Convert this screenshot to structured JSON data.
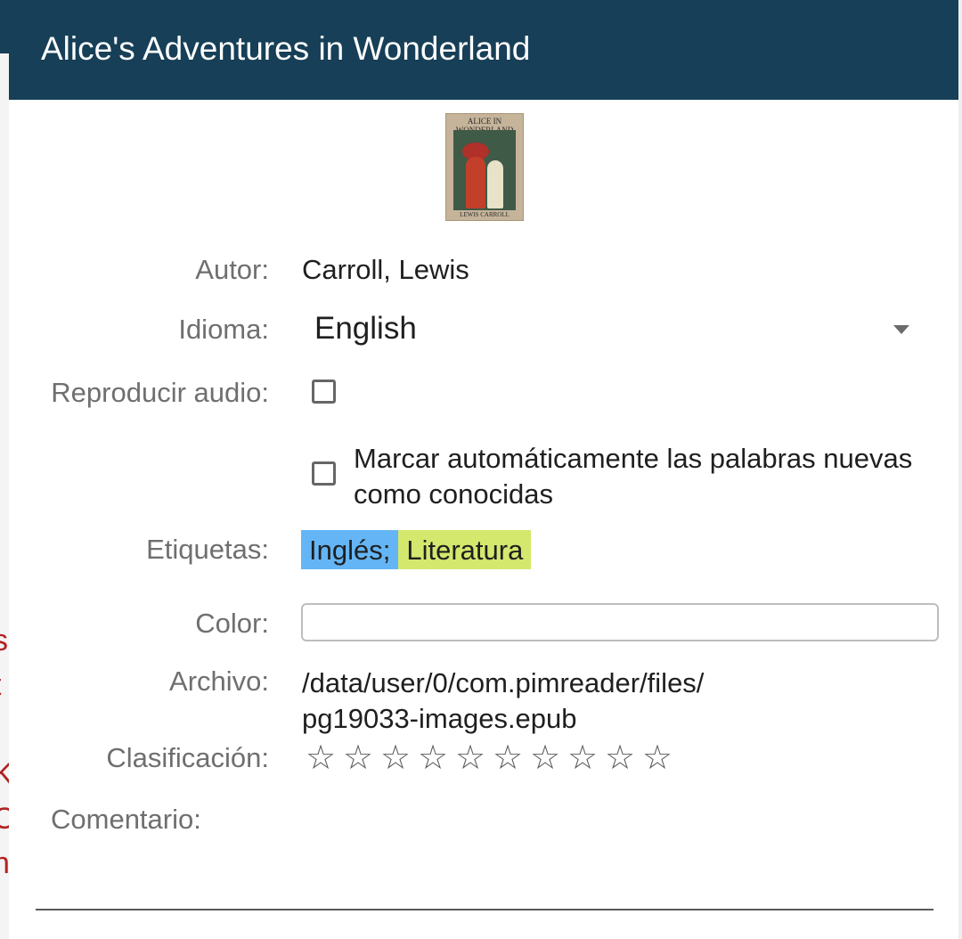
{
  "dialog": {
    "title": "Alice's Adventures in Wonderland"
  },
  "cover": {
    "title_text": "ALICE IN WONDERLAND",
    "author_text": "LEWIS CARROLL"
  },
  "fields": {
    "author": {
      "label": "Autor:",
      "value": "Carroll, Lewis"
    },
    "language": {
      "label": "Idioma:",
      "selected": "English"
    },
    "play_audio": {
      "label": "Reproducir audio:",
      "checked": false
    },
    "auto_mark": {
      "text": "Marcar automáticamente las palabras nuevas como conocidas",
      "checked": false
    },
    "tags": {
      "label": "Etiquetas:",
      "items": [
        {
          "text": "Inglés;",
          "color": "#64b5f6"
        },
        {
          "text": "Literatura",
          "color": "#d4e86e"
        }
      ]
    },
    "color": {
      "label": "Color:",
      "value": ""
    },
    "file": {
      "label": "Archivo:",
      "line1": "/data/user/0/com.pimreader/files/",
      "line2": "pg19033-images.epub"
    },
    "rating": {
      "label": "Clasificación:",
      "value": 0,
      "max": 10
    },
    "comment": {
      "label": "Comentario:",
      "value": ""
    }
  },
  "colors": {
    "titlebar": "#173f57",
    "label_text": "#6f6f6f",
    "value_text": "#1f1f1f"
  }
}
